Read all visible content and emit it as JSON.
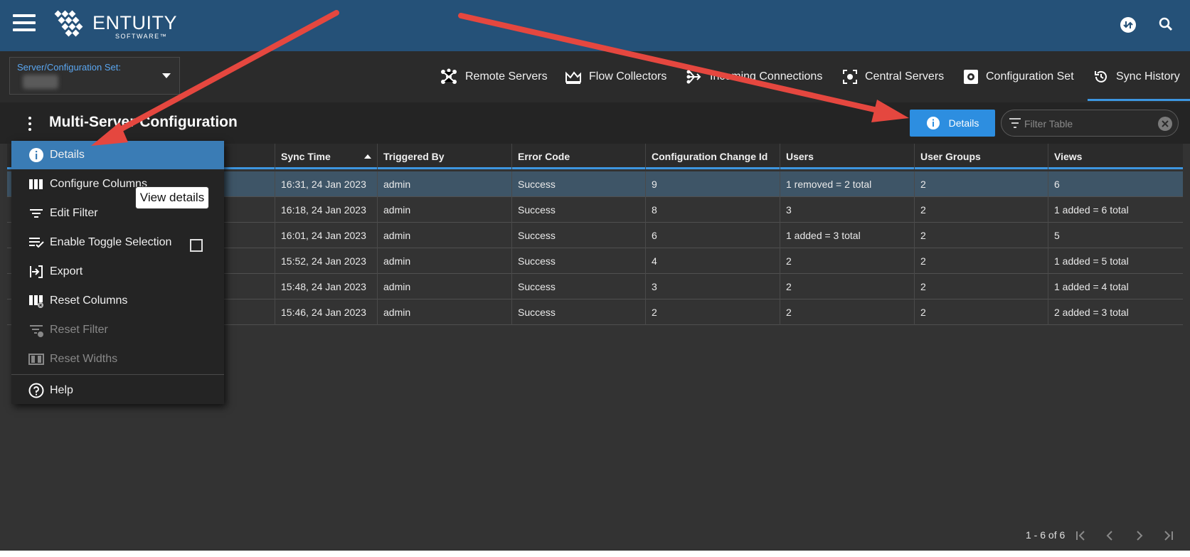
{
  "brand": {
    "name": "ENTUITY",
    "sub": "SOFTWARE™"
  },
  "server_select": {
    "label": "Server/Configuration Set:"
  },
  "tabs": [
    {
      "label": "Remote Servers",
      "icon": "remote-servers-icon"
    },
    {
      "label": "Flow Collectors",
      "icon": "flow-collectors-icon"
    },
    {
      "label": "Incoming Connections",
      "icon": "incoming-connections-icon"
    },
    {
      "label": "Central Servers",
      "icon": "central-servers-icon"
    },
    {
      "label": "Configuration Set",
      "icon": "configuration-set-icon"
    },
    {
      "label": "Sync History",
      "icon": "sync-history-icon"
    }
  ],
  "active_tab": "Sync History",
  "page": {
    "title": "Multi-Server Configuration"
  },
  "details_button": {
    "label": "Details"
  },
  "filter": {
    "placeholder": "Filter Table"
  },
  "table": {
    "columns": [
      "Sync Time",
      "Triggered By",
      "Error Code",
      "Configuration Change Id",
      "Users",
      "User Groups",
      "Views"
    ],
    "sort_column": "Sync Time",
    "rows": [
      [
        "16:31, 24 Jan 2023",
        "admin",
        "Success",
        "9",
        "1 removed = 2 total",
        "2",
        "6"
      ],
      [
        "16:18, 24 Jan 2023",
        "admin",
        "Success",
        "8",
        "3",
        "2",
        "1 added = 6 total"
      ],
      [
        "16:01, 24 Jan 2023",
        "admin",
        "Success",
        "6",
        "1 added = 3 total",
        "2",
        "5"
      ],
      [
        "15:52, 24 Jan 2023",
        "admin",
        "Success",
        "4",
        "2",
        "2",
        "1 added = 5 total"
      ],
      [
        "15:48, 24 Jan 2023",
        "admin",
        "Success",
        "3",
        "2",
        "2",
        "1 added = 4 total"
      ],
      [
        "15:46, 24 Jan 2023",
        "admin",
        "Success",
        "2",
        "2",
        "2",
        "2 added = 3 total"
      ]
    ],
    "selected_row": 0
  },
  "pagination": {
    "text": "1 - 6 of 6"
  },
  "menu": {
    "items": [
      {
        "label": "Details",
        "icon": "info-icon",
        "state": "active"
      },
      {
        "label": "Configure Columns",
        "icon": "columns-icon",
        "state": "normal"
      },
      {
        "label": "Edit Filter",
        "icon": "filter-icon",
        "state": "normal"
      },
      {
        "label": "Enable Toggle Selection",
        "icon": "toggle-selection-icon",
        "state": "normal"
      },
      {
        "label": "Export",
        "icon": "export-icon",
        "state": "normal"
      },
      {
        "label": "Reset Columns",
        "icon": "reset-columns-icon",
        "state": "normal"
      },
      {
        "label": "Reset Filter",
        "icon": "reset-filter-icon",
        "state": "disabled"
      },
      {
        "label": "Reset Widths",
        "icon": "reset-widths-icon",
        "state": "disabled"
      },
      {
        "label": "Help",
        "icon": "help-icon",
        "state": "normal"
      }
    ],
    "toggle_selection_checked": false
  },
  "tooltip": {
    "text": "View details"
  },
  "colors": {
    "topbar": "#255178",
    "accent": "#2d8ee0",
    "selected_row": "#3e5567",
    "annotation_arrow": "#e5473f"
  }
}
